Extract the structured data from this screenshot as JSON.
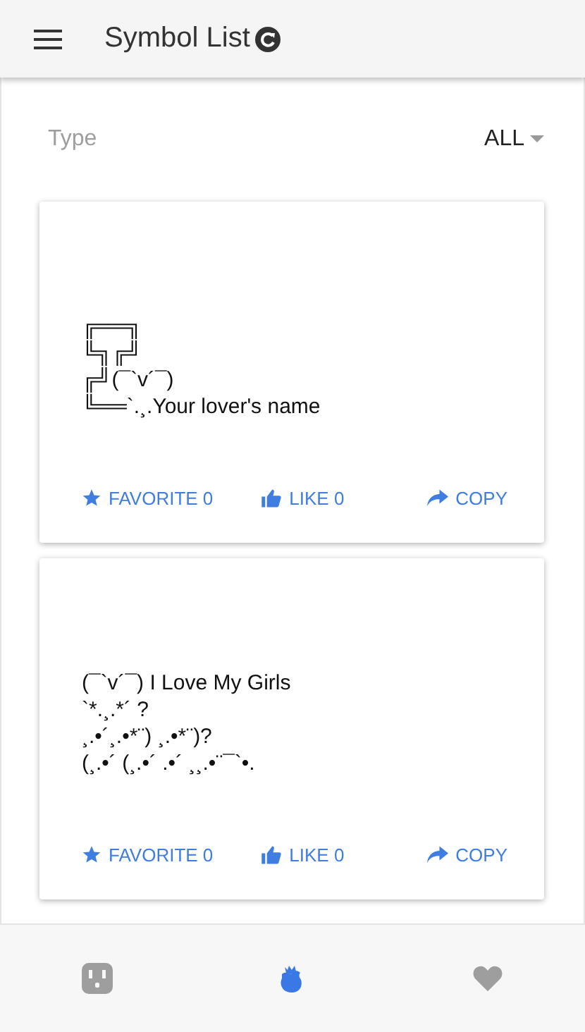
{
  "app_bar": {
    "title": "Symbol List"
  },
  "filter": {
    "label": "Type",
    "value": "ALL"
  },
  "cards": [
    {
      "lines": [
        "╔══╗",
        "╚╗╔╝",
        "╔╝(¯`v´¯)",
        "╚══`.¸.Your lover's name"
      ],
      "actions": [
        {
          "kind": "favorite",
          "label": "FAVORITE 0"
        },
        {
          "kind": "like",
          "label": "LIKE 0"
        },
        {
          "kind": "copy",
          "label": "COPY"
        }
      ]
    },
    {
      "lines": [
        "(¯`v´¯) I Love My Girls",
        "`*.¸.*´ ?",
        "¸.•´¸.•*¨) ¸.•*¨)?",
        "(¸.•´ (¸.•´ .•´ ¸¸.•¨¯`•."
      ],
      "actions": [
        {
          "kind": "favorite",
          "label": "FAVORITE 0"
        },
        {
          "kind": "like",
          "label": "LIKE 0"
        },
        {
          "kind": "copy",
          "label": "COPY"
        }
      ]
    }
  ],
  "bottom_nav": [
    {
      "kind": "outlet",
      "selected": false
    },
    {
      "kind": "rose",
      "selected": true
    },
    {
      "kind": "heart",
      "selected": false
    }
  ]
}
